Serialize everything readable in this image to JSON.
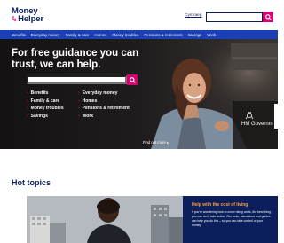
{
  "header": {
    "logo_line1": "Money",
    "logo_line2": "Helper",
    "language_link": "Cymraeg",
    "search_placeholder": ""
  },
  "nav": {
    "items": [
      "Benefits",
      "Everyday money",
      "Family & care",
      "Homes",
      "Money troubles",
      "Pensions & retirement",
      "Savings",
      "Work"
    ]
  },
  "hero": {
    "title": "For free guidance you can trust, we can help.",
    "search_placeholder": "",
    "links": [
      "Benefits",
      "Everyday money",
      "Family & care",
      "Homes",
      "Money troubles",
      "Pensions & retirement",
      "Savings",
      "Work"
    ],
    "find_out_more": "Find out more",
    "gov_logo_text": "HM Governm"
  },
  "hot_topics": {
    "heading": "Hot topics",
    "card": {
      "title": "Help with the cost of living",
      "description": "If you're wondering how to cover rising costs, the best thing you can do is take action. Our tools, calculators and guides can help you do this – so you can take control of your money."
    }
  },
  "colors": {
    "brand_navy": "#0a1f5c",
    "brand_pink": "#d6006e",
    "nav_blue": "#1b3fb5",
    "card_title_orange": "#ff9e3d"
  }
}
